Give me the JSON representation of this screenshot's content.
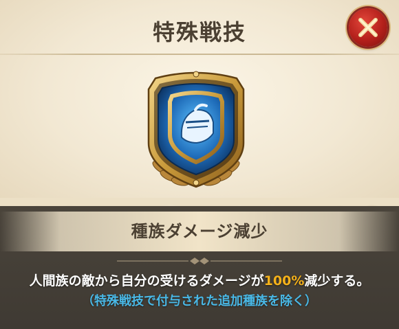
{
  "dialog": {
    "title": "特殊戦技",
    "close_icon": "close-x-icon"
  },
  "emblem": {
    "icon": "knight-helmet-shield-icon",
    "colors": {
      "gold": "#c99a3a",
      "blue": "#1e6bb8",
      "helmet": "#e8f4ff"
    }
  },
  "skill": {
    "name": "種族ダメージ減少",
    "description_before": "人間族の敵から自分の受けるダメージが",
    "description_value": "100%",
    "description_after": "減少する。",
    "note": "（特殊戦技で付与された追加種族を除く）"
  },
  "colors": {
    "accent_value": "#f5b11a",
    "note": "#49b8e6",
    "close_button": "#c0271f"
  }
}
